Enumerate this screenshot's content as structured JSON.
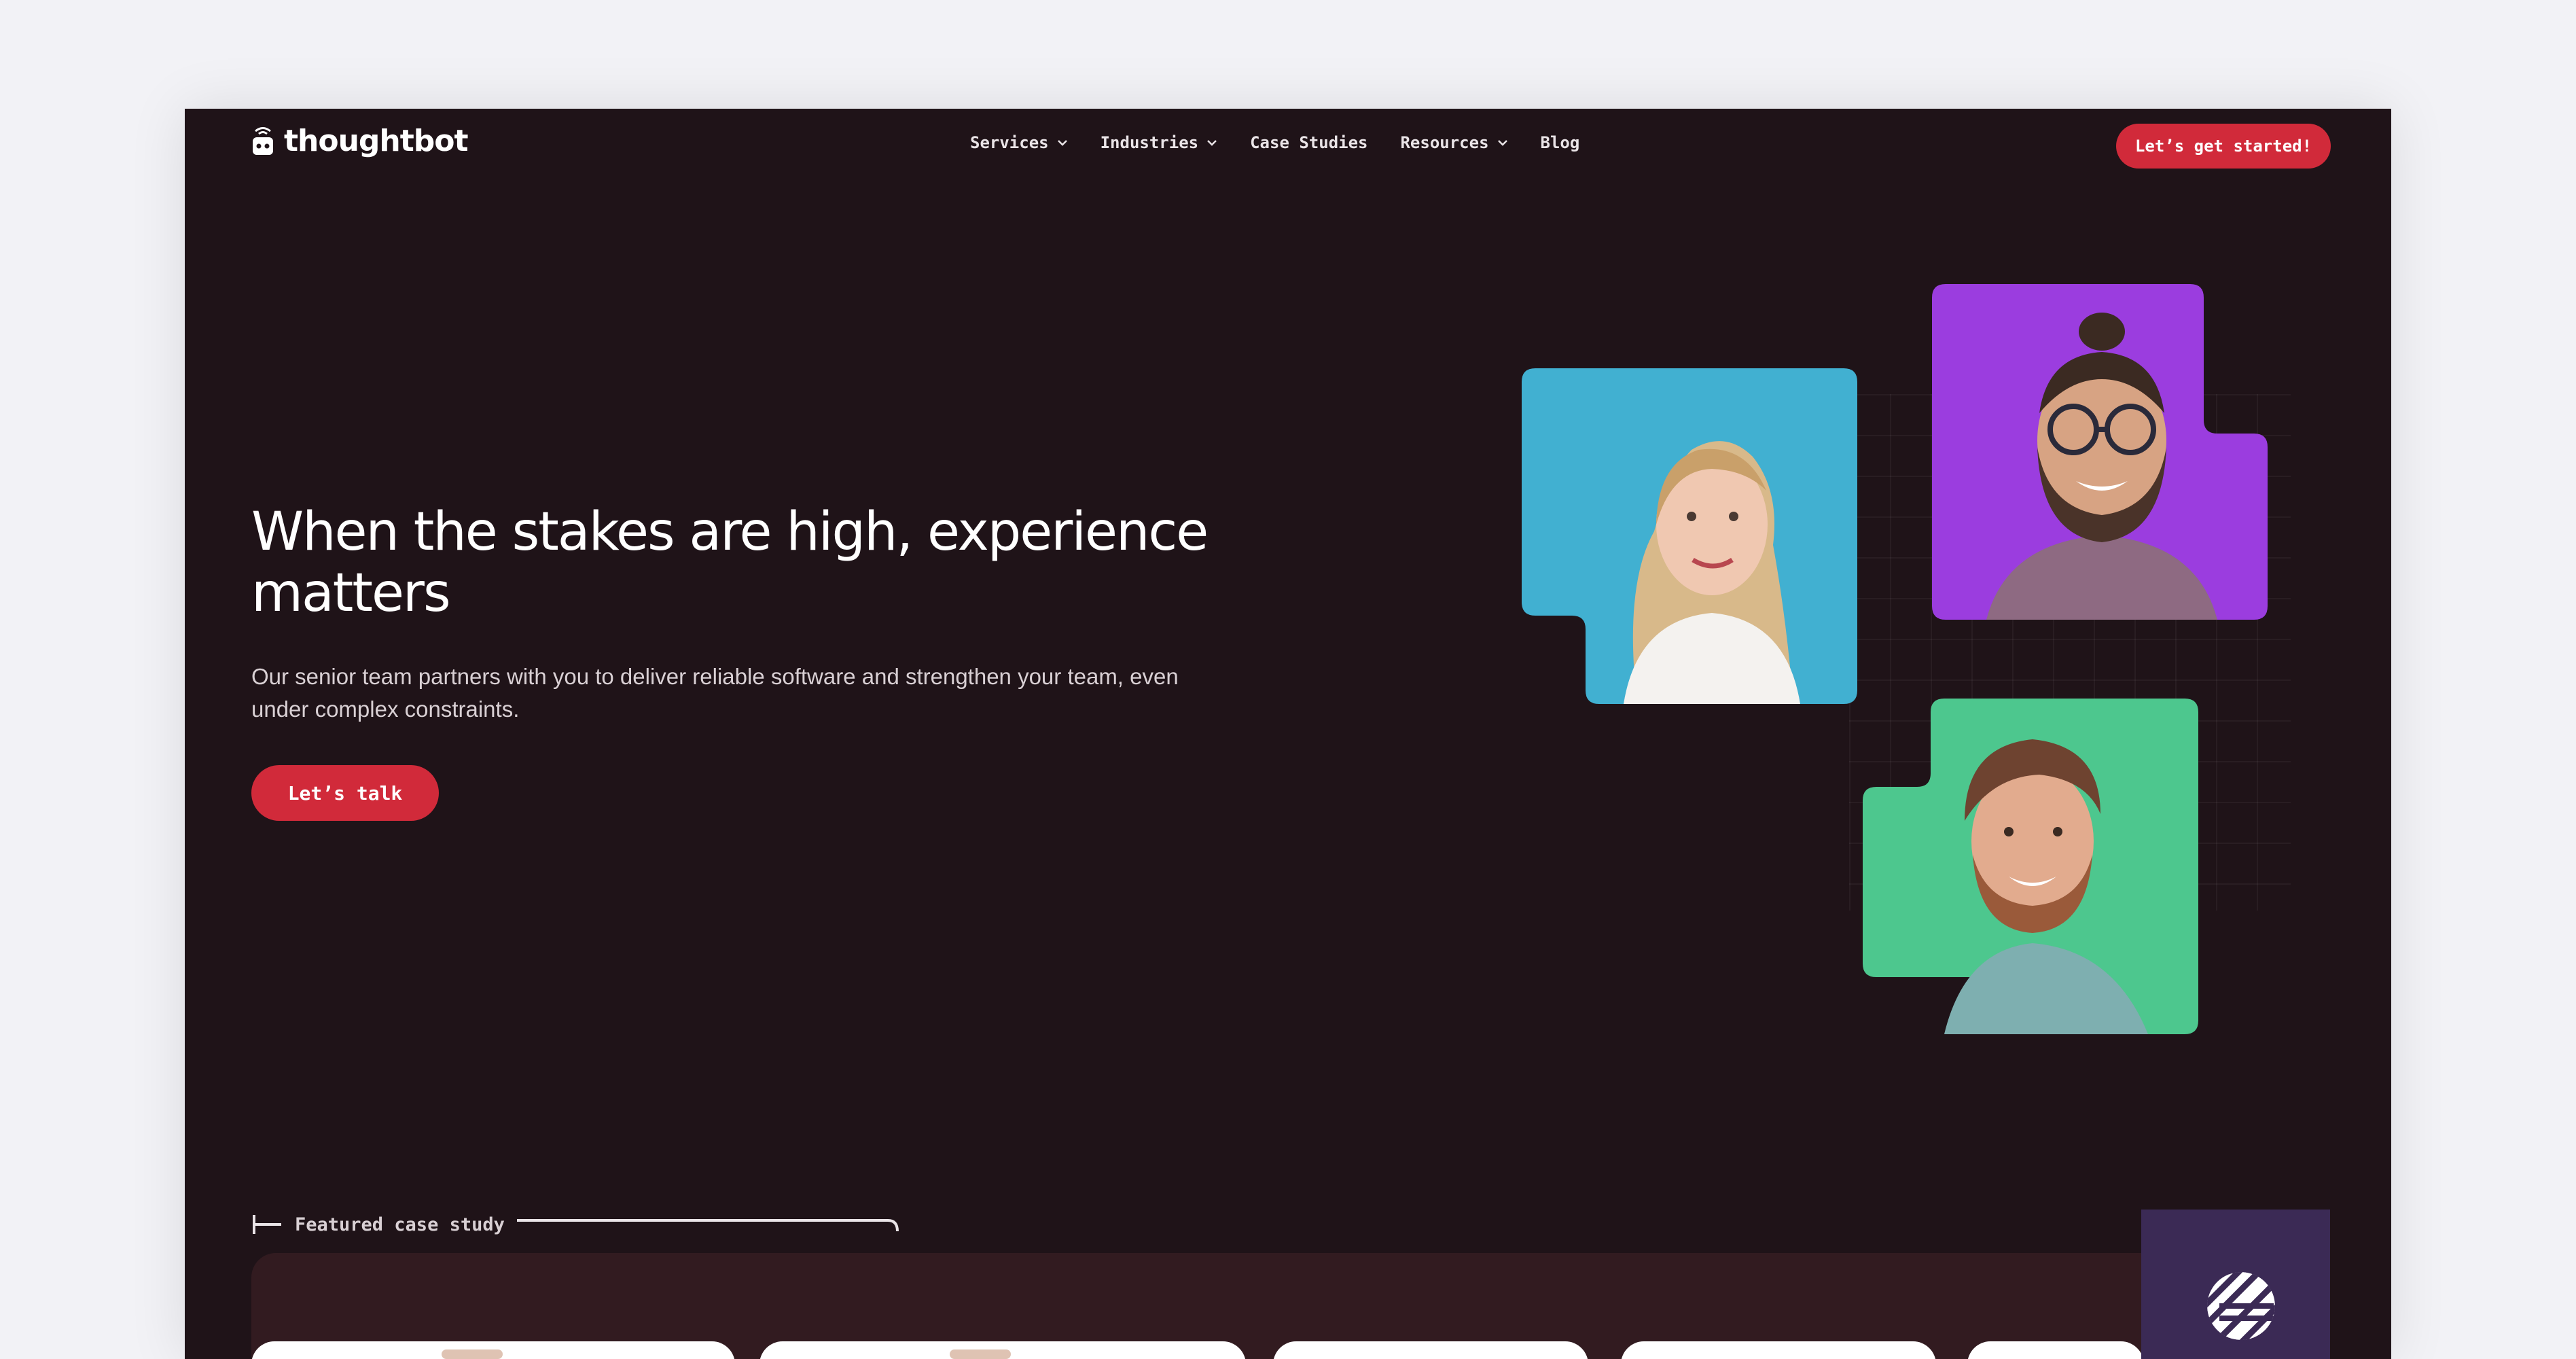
{
  "header": {
    "logo_text": "thoughtbot",
    "logo_icon": "robot-icon",
    "nav": [
      {
        "label": "Services",
        "dropdown": true
      },
      {
        "label": "Industries",
        "dropdown": true
      },
      {
        "label": "Case Studies",
        "dropdown": false
      },
      {
        "label": "Resources",
        "dropdown": true
      },
      {
        "label": "Blog",
        "dropdown": false
      }
    ],
    "cta_label": "Let’s get started!"
  },
  "hero": {
    "title": "When the stakes are high, experience matters",
    "subtitle": "Our senior team partners with you to deliver reliable software and strengthen your team, even under complex constraints.",
    "cta_label": "Let’s talk"
  },
  "portraits": [
    {
      "name": "portrait-woman",
      "background": "#41b0d1"
    },
    {
      "name": "portrait-man-glasses",
      "background": "#9b3ddf"
    },
    {
      "name": "portrait-man-beard",
      "background": "#4dc78e"
    }
  ],
  "featured": {
    "label": "Featured case study",
    "client_logo_icon": "striped-circle-logo-icon"
  },
  "colors": {
    "page_background": "#1f1318",
    "accent": "#d12a3a",
    "case_panel": "#321b20",
    "client_logo_background": "#3b2a55"
  }
}
